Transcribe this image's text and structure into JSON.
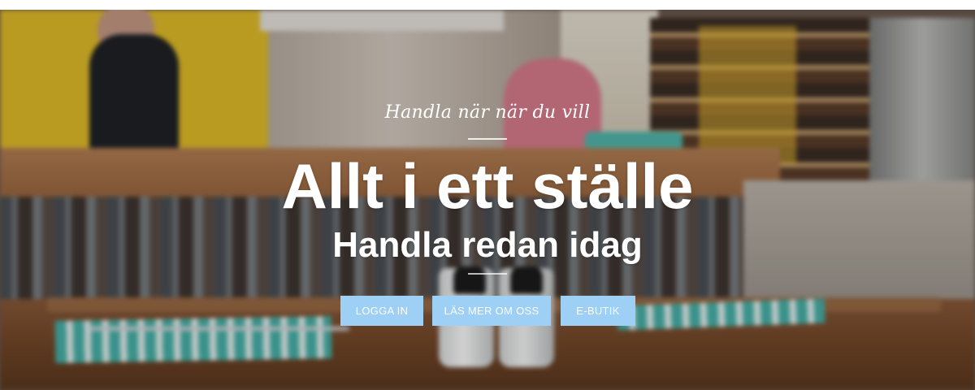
{
  "hero": {
    "tagline": "Handla när när du vill",
    "headline": "Allt i ett ställe",
    "subheadline": "Handla redan idag",
    "buttons": {
      "login": "LOGGA IN",
      "about": "LÄS MER OM OSS",
      "shop": "E-BUTIK"
    }
  },
  "colors": {
    "button_background": "#9ecff5",
    "button_text": "#ffffff",
    "heading_text": "#ffffff"
  }
}
